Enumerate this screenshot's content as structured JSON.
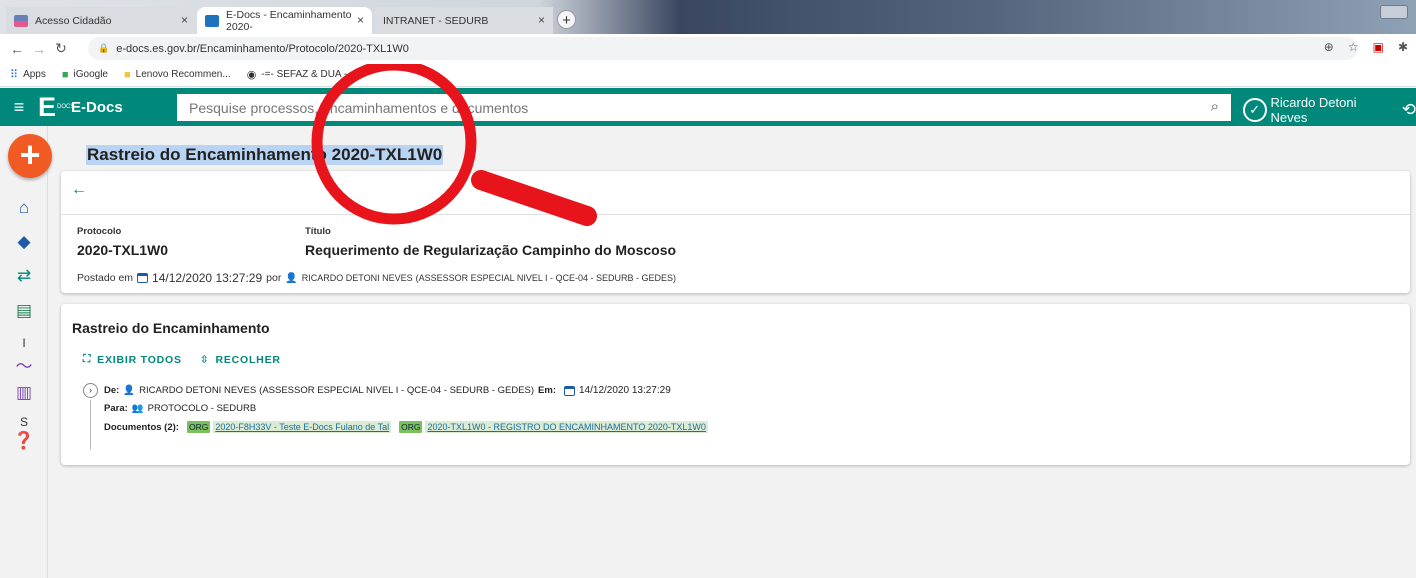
{
  "browser": {
    "tabs": [
      {
        "label": "Acesso Cidadão",
        "active": false,
        "favicon_color": "#6c7fb8"
      },
      {
        "label": "E-Docs - Encaminhamento 2020-",
        "active": true,
        "favicon_color": "#1e73be"
      },
      {
        "label": "INTRANET - SEDURB",
        "active": false,
        "favicon_color": ""
      }
    ],
    "tab_close_glyph": "×",
    "new_tab_glyph": "+",
    "url": "e-docs.es.gov.br/Encaminhamento/Protocolo/2020-TXL1W0",
    "nav_icons": [
      "back-icon",
      "forward-icon",
      "reload-icon"
    ],
    "omnibox_icons": [
      "zoom-icon",
      "star-icon",
      "pdf-icon",
      "extension-icon"
    ],
    "bookmarks": [
      {
        "label": "Apps",
        "icon": "apps-grid-icon"
      },
      {
        "label": "iGoogle",
        "icon": "igoogle-icon"
      },
      {
        "label": "Lenovo Recommen...",
        "icon": "folder-icon"
      },
      {
        "label": "-=- SEFAZ & DUA -...",
        "icon": "globe-icon"
      }
    ]
  },
  "app": {
    "brand": "E-Docs",
    "logo_letter": "E",
    "logo_sub": "DOCS",
    "search_placeholder": "Pesquise processos, encaminhamentos e documentos",
    "user_name": "Ricardo Detoni Neves",
    "header_color": "#00897b",
    "accent_color": "#f15a22"
  },
  "sidebar": {
    "icons": [
      "home-icon",
      "bookmark-icon",
      "transfer-icon",
      "document-icon",
      "trend-icon",
      "bar-chart-icon",
      "help-icon"
    ],
    "labels": [
      "I",
      "S"
    ]
  },
  "page": {
    "title": "Rastreio do Encaminhamento 2020-TXL1W0",
    "protocolo_label": "Protocolo",
    "protocolo_value": "2020-TXL1W0",
    "titulo_label": "Título",
    "titulo_value": "Requerimento de Regularização Campinho do Moscoso",
    "posted_prefix": "Postado em",
    "posted_date": "14/12/2020 13:27:29",
    "posted_by": "por",
    "posted_user": "RICARDO DETONI NEVES",
    "posted_role": "(ASSESSOR ESPECIAL NIVEL I - QCE-04 - SEDURB - GEDES)"
  },
  "tracking": {
    "title": "Rastreio do Encaminhamento",
    "show_all": "EXIBIR TODOS",
    "collapse": "RECOLHER",
    "from_label": "De:",
    "from_user": "RICARDO DETONI NEVES",
    "from_role": "(ASSESSOR ESPECIAL NIVEL I - QCE-04 - SEDURB - GEDES)",
    "at_label": "Em:",
    "at_date": "14/12/2020 13:27:29",
    "to_label": "Para:",
    "to_value": "PROTOCOLO - SEDURB",
    "docs_label": "Documentos (2):",
    "docs": [
      {
        "tag": "ORG",
        "label": "2020-F8H33V - Teste E-Docs Fulano de Tal"
      },
      {
        "tag": "ORG",
        "label": "2020-TXL1W0 - REGISTRO DO ENCAMINHAMENTO 2020-TXL1W0"
      }
    ]
  },
  "annotation": {
    "type": "magnifier-overlay",
    "color": "#e8141b"
  }
}
